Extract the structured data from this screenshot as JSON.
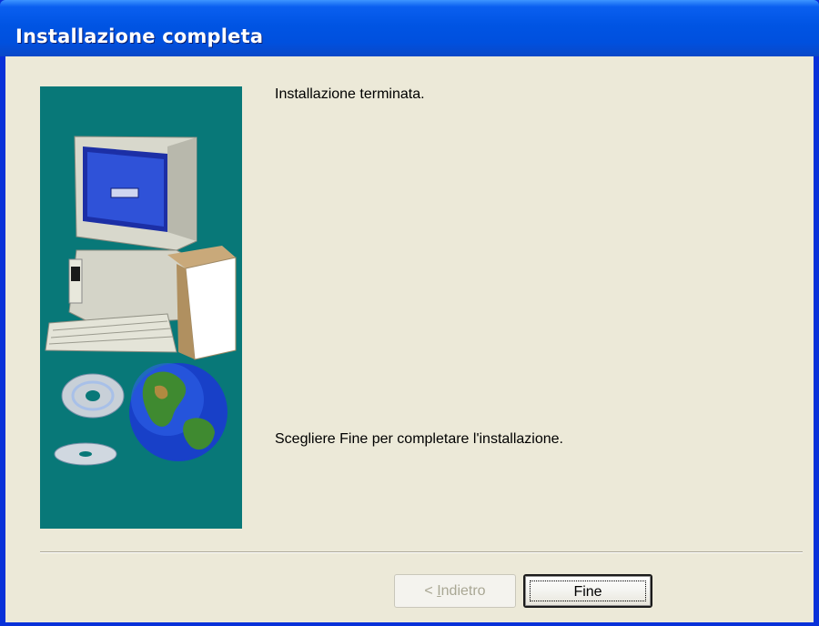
{
  "window": {
    "title": "Installazione completa"
  },
  "content": {
    "status_text": "Installazione terminata.",
    "instruction_text": "Scegliere Fine per completare l'installazione."
  },
  "buttons": {
    "back_prefix": "< ",
    "back_mnemonic": "I",
    "back_rest": "ndietro",
    "finish_label": "Fine"
  },
  "colors": {
    "titlebar": "#0054e3",
    "dialog_bg": "#ece9d8",
    "image_bg": "#087878"
  }
}
